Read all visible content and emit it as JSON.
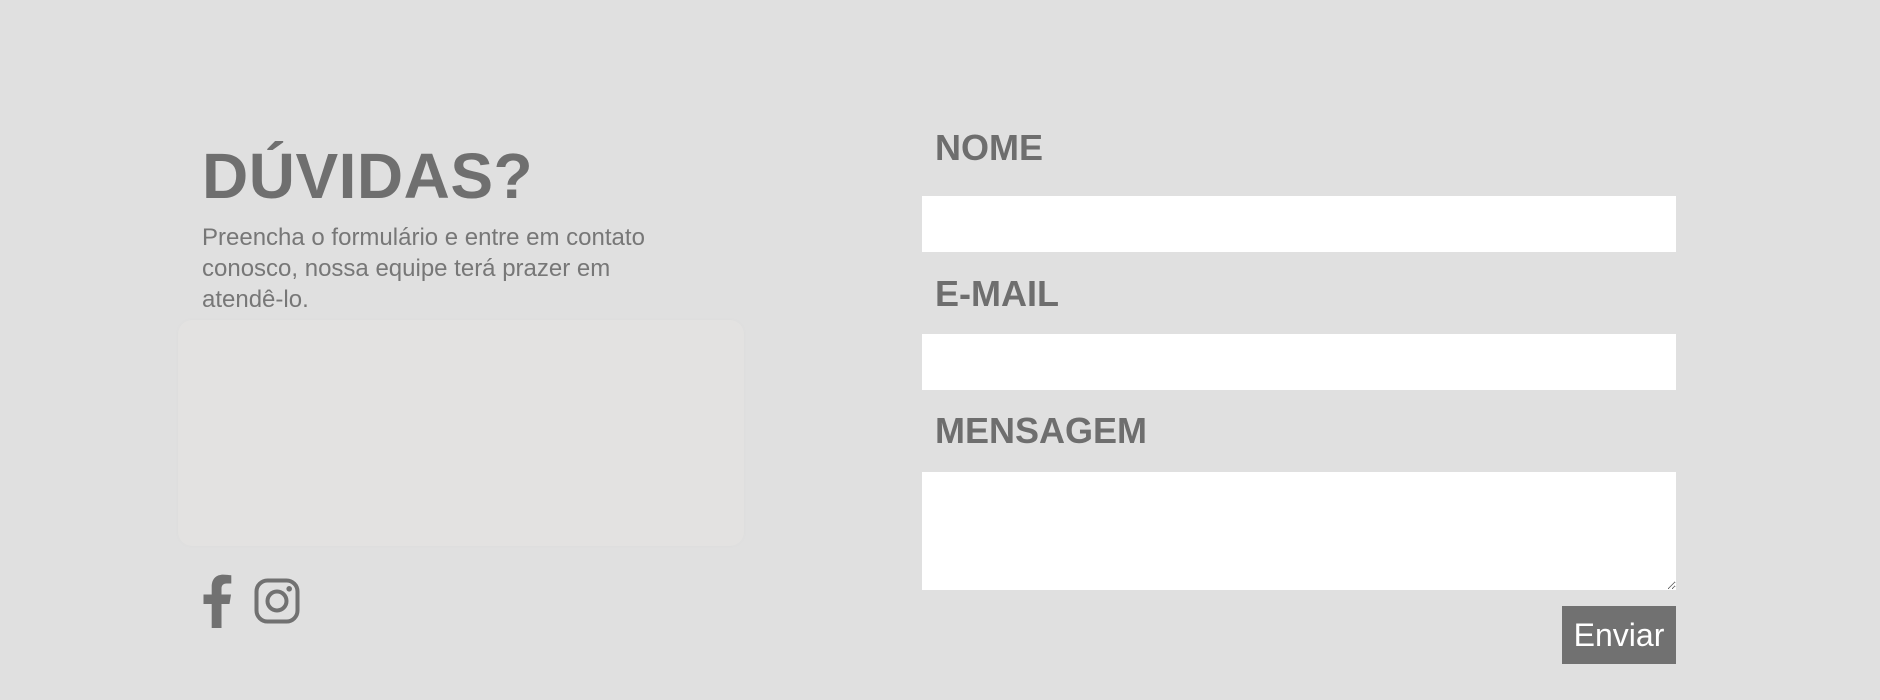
{
  "contact": {
    "heading": "DÚVIDAS?",
    "description": "Preencha o formulário e entre em contato conosco, nossa equipe terá prazer em atendê-lo."
  },
  "social": {
    "icons": [
      "facebook-icon",
      "instagram-icon"
    ]
  },
  "form": {
    "name_label": "NOME",
    "name_value": "",
    "email_label": "E-MAIL",
    "email_value": "",
    "message_label": "MENSAGEM",
    "message_value": "",
    "submit_label": "Enviar"
  },
  "colors": {
    "background": "#e0e0e0",
    "text": "#717171",
    "button": "#717171",
    "input_background": "#ffffff"
  }
}
